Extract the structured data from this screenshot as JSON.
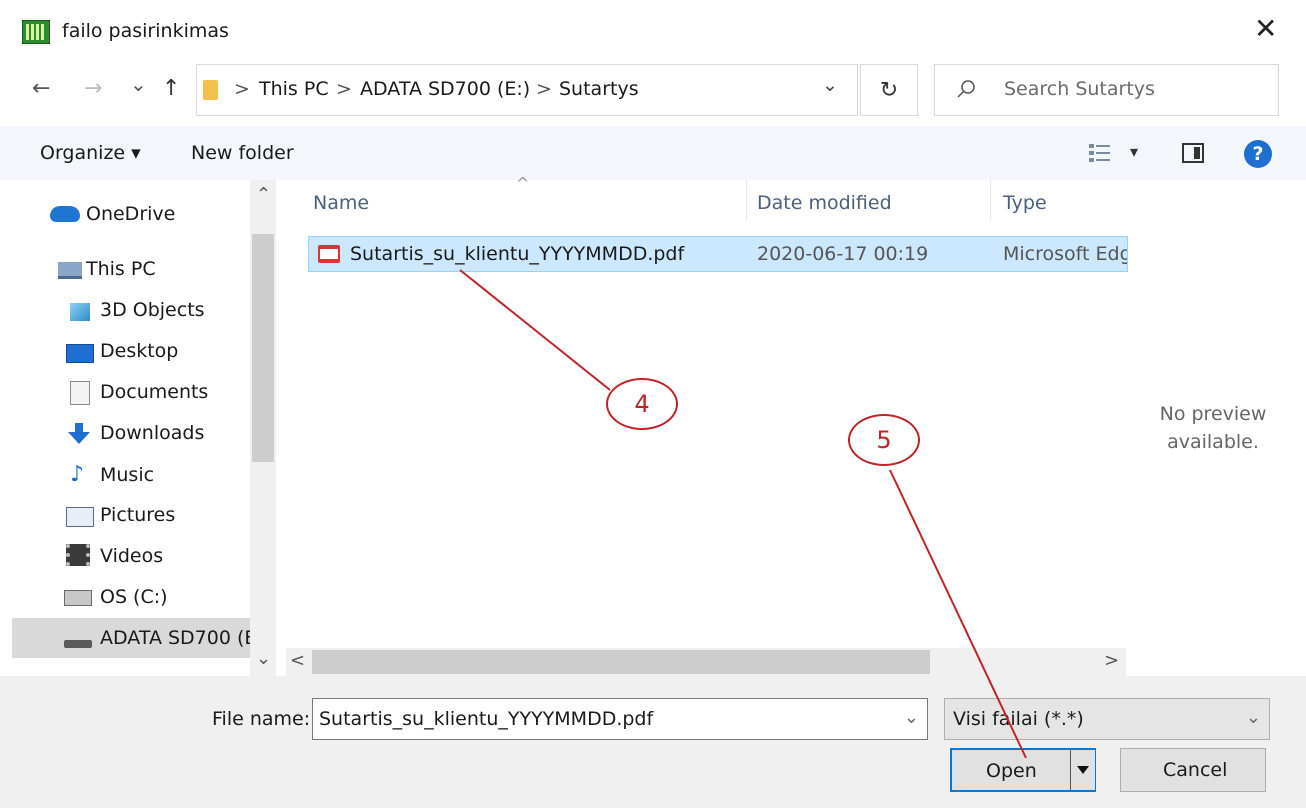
{
  "window": {
    "title": "failo pasirinkimas",
    "close_glyph": "✕"
  },
  "nav": {
    "back": "←",
    "forward": "→",
    "recent": "⌄",
    "up": "↑",
    "breadcrumb": [
      "This PC",
      "ADATA SD700 (E:)",
      "Sutartys"
    ],
    "separator": ">",
    "address_dropdown": "⌄",
    "refresh": "↻",
    "search_placeholder": "Search Sutartys"
  },
  "toolbar": {
    "organize": "Organize ▾",
    "new_folder": "New folder",
    "view_dropdown": "▾"
  },
  "sidebar": {
    "items": [
      {
        "label": "OneDrive",
        "icon": "cloud-icon"
      },
      {
        "label": "This PC",
        "icon": "computer-icon"
      },
      {
        "label": "3D Objects",
        "icon": "cube-icon"
      },
      {
        "label": "Desktop",
        "icon": "desktop-icon"
      },
      {
        "label": "Documents",
        "icon": "document-icon"
      },
      {
        "label": "Downloads",
        "icon": "download-icon"
      },
      {
        "label": "Music",
        "icon": "music-icon"
      },
      {
        "label": "Pictures",
        "icon": "pictures-icon"
      },
      {
        "label": "Videos",
        "icon": "videos-icon"
      },
      {
        "label": "OS (C:)",
        "icon": "drive-icon"
      },
      {
        "label": "ADATA SD700 (E",
        "icon": "usb-drive-icon"
      }
    ],
    "scroll_up": "⌃",
    "scroll_down": "⌄"
  },
  "file_list": {
    "columns": [
      "Name",
      "Date modified",
      "Type"
    ],
    "sort_glyph": "^",
    "rows": [
      {
        "name": "Sutartis_su_klientu_YYYYMMDD.pdf",
        "date_modified": "2020-06-17 00:19",
        "type": "Microsoft Edg"
      }
    ],
    "scroll_left": "<",
    "scroll_right": ">"
  },
  "preview": {
    "line1": "No preview",
    "line2": "available."
  },
  "footer": {
    "file_name_label": "File name:",
    "file_name_value": "Sutartis_su_klientu_YYYYMMDD.pdf",
    "file_type_value": "Visi failai (*.*)",
    "open_label": "Open",
    "cancel_label": "Cancel"
  },
  "annotations": {
    "step4": "4",
    "step5": "5"
  },
  "colors": {
    "accent": "#0078d7",
    "selection": "#cce8ff",
    "annotation": "#c0232a"
  }
}
